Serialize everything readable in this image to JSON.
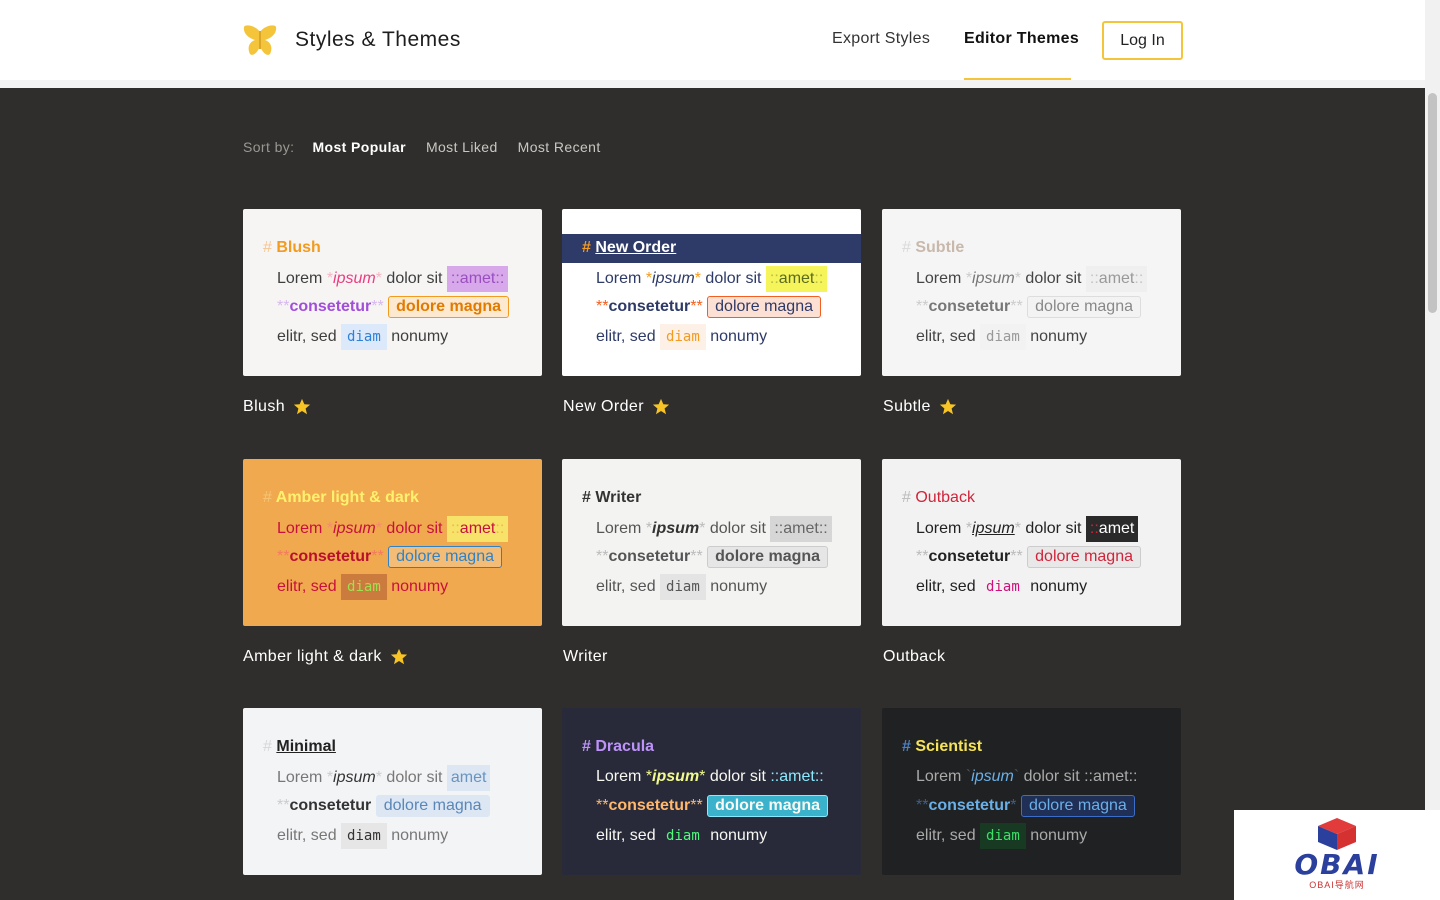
{
  "header": {
    "brand": "Styles & Themes",
    "nav": {
      "export": "Export Styles",
      "editor": "Editor Themes"
    },
    "login": "Log In"
  },
  "sort": {
    "label": "Sort by:",
    "options": [
      "Most Popular",
      "Most Liked",
      "Most Recent"
    ],
    "active": "Most Popular"
  },
  "sample": {
    "hash": "#",
    "lorem": "Lorem",
    "ipsum": "ipsum",
    "star": "*",
    "dolor": "dolor sit",
    "amet": "amet",
    "colons": "::",
    "stars2": "**",
    "consetetur": "consetetur",
    "dolore": "dolore magna",
    "elitr": "elitr, sed",
    "tick": "`",
    "diam": "diam",
    "nonumy": "nonumy"
  },
  "themes": [
    {
      "name": "Blush",
      "favorite": true
    },
    {
      "name": "New Order",
      "favorite": true
    },
    {
      "name": "Subtle",
      "favorite": true
    },
    {
      "name": "Amber light & dark",
      "favorite": true
    },
    {
      "name": "Writer",
      "favorite": false
    },
    {
      "name": "Outback",
      "favorite": false
    },
    {
      "name": "Minimal",
      "favorite": false
    },
    {
      "name": "Dracula",
      "favorite": false
    },
    {
      "name": "Scientist",
      "favorite": false
    }
  ],
  "colors": {
    "accent": "#f4c43a",
    "background": "#2f2e2c",
    "star": "#f7c325"
  },
  "watermark": {
    "text": "OBAI",
    "subtext": "OBAI导航网"
  }
}
